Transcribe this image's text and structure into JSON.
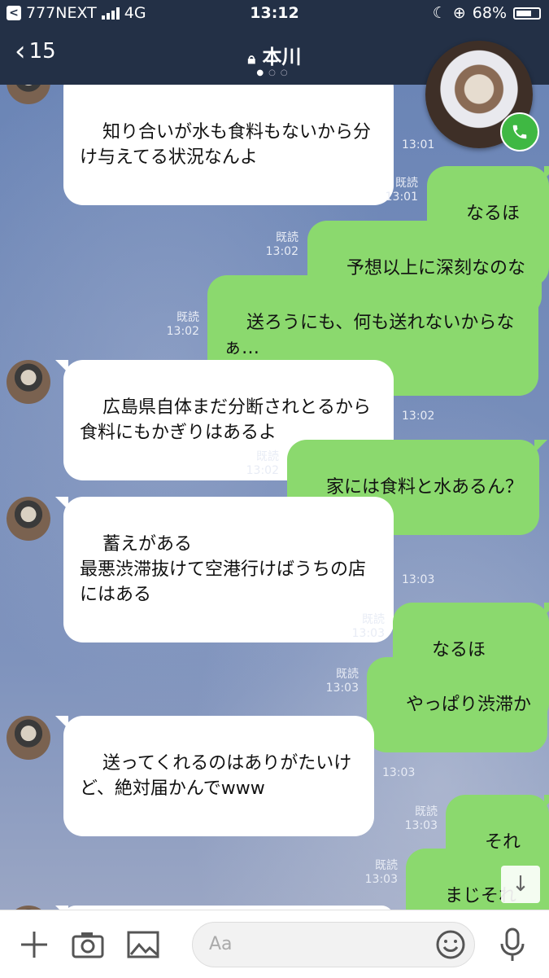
{
  "status_bar": {
    "back_app": "777NEXT",
    "network": "4G",
    "time": "13:12",
    "battery": "68%"
  },
  "header": {
    "back_count": "15",
    "title": "本川"
  },
  "messages": [
    {
      "side": "in",
      "text": "知り合いが水も食料もないから分け与えてる状況なんよ",
      "time": "13:01"
    },
    {
      "side": "out",
      "text": "なるほど",
      "read": "既読",
      "time": "13:01"
    },
    {
      "side": "out",
      "text": "予想以上に深刻なのな",
      "read": "既読",
      "time": "13:02"
    },
    {
      "side": "out",
      "text": "送ろうにも、何も送れないからなぁ…",
      "read": "既読",
      "time": "13:02"
    },
    {
      "side": "in",
      "text": "広島県自体まだ分断されとるから食料にもかぎりはあるよ",
      "time": "13:02"
    },
    {
      "side": "out",
      "text": "家には食料と水あるん？",
      "read": "既読",
      "time": "13:02"
    },
    {
      "side": "in",
      "text": "蓄えがある\n最悪渋滞抜けて空港行けばうちの店にはある",
      "time": "13:03"
    },
    {
      "side": "out",
      "text": "なるほど……",
      "read": "既読",
      "time": "13:03"
    },
    {
      "side": "out",
      "text": "やっぱり渋滞か",
      "read": "既読",
      "time": "13:03"
    },
    {
      "side": "in",
      "text": "送ってくれるのはありがたいけど、絶対届かんでwww",
      "time": "13:03"
    },
    {
      "side": "out",
      "text": "それな",
      "read": "既読",
      "time": "13:03"
    },
    {
      "side": "out",
      "text": "まじそれな",
      "read": "既読",
      "time": "13:03"
    }
  ],
  "composer": {
    "placeholder": "Aa"
  },
  "colors": {
    "header_bg": "#233046",
    "outgoing_bubble": "#8bd96e",
    "incoming_bubble": "#ffffff",
    "call_button": "#3fb843"
  },
  "icons": [
    "back-chevron-icon",
    "lock-icon",
    "phone-icon",
    "plus-icon",
    "camera-icon",
    "image-icon",
    "emoji-icon",
    "microphone-icon",
    "arrow-down-icon"
  ]
}
